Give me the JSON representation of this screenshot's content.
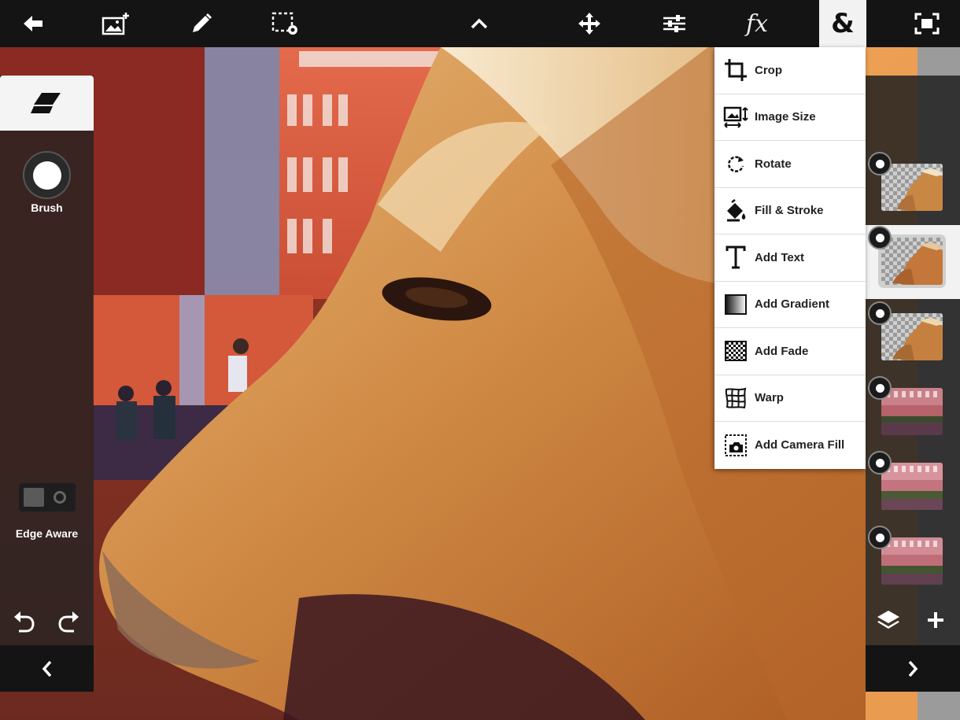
{
  "toolbar": {
    "tools": [
      {
        "name": "back",
        "icon": "back-arrow-icon"
      },
      {
        "name": "add-image",
        "icon": "add-image-icon"
      },
      {
        "name": "brush",
        "icon": "pencil-icon"
      },
      {
        "name": "selection",
        "icon": "selection-settings-icon"
      },
      {
        "name": "collapse",
        "icon": "chevron-up-icon"
      },
      {
        "name": "move",
        "icon": "move-icon"
      },
      {
        "name": "adjustments",
        "icon": "sliders-icon"
      },
      {
        "name": "effects",
        "icon": "fx-icon",
        "label": "fx"
      },
      {
        "name": "more",
        "icon": "ampersand-icon",
        "label": "&",
        "active": true
      },
      {
        "name": "fullscreen",
        "icon": "fullscreen-icon"
      }
    ]
  },
  "left_panel": {
    "active_tool_icon": "eraser-icon",
    "brush_label": "Brush",
    "edge_aware_label": "Edge Aware",
    "edge_aware_on": false
  },
  "menu": {
    "items": [
      {
        "label": "Crop",
        "icon": "crop-icon"
      },
      {
        "label": "Image Size",
        "icon": "image-size-icon"
      },
      {
        "label": "Rotate",
        "icon": "rotate-icon"
      },
      {
        "label": "Fill & Stroke",
        "icon": "fill-stroke-icon"
      },
      {
        "label": "Add Text",
        "icon": "text-icon"
      },
      {
        "label": "Add Gradient",
        "icon": "gradient-icon"
      },
      {
        "label": "Add Fade",
        "icon": "fade-icon"
      },
      {
        "label": "Warp",
        "icon": "warp-icon"
      },
      {
        "label": "Add Camera Fill",
        "icon": "camera-fill-icon"
      }
    ]
  },
  "layers": {
    "items": [
      {
        "thumb": "horse-head-transparent",
        "selected": false
      },
      {
        "thumb": "horse-head-transparent",
        "selected": true
      },
      {
        "thumb": "horse-head-transparent",
        "selected": false
      },
      {
        "thumb": "street-building",
        "selected": false
      },
      {
        "thumb": "street-building",
        "selected": false
      },
      {
        "thumb": "street-building",
        "selected": false
      }
    ]
  },
  "colors": {
    "toolbar_bg": "#141414",
    "panel_bg": "#222222",
    "menu_bg": "#ffffff",
    "active_tab_bg": "#f2f2f2"
  }
}
